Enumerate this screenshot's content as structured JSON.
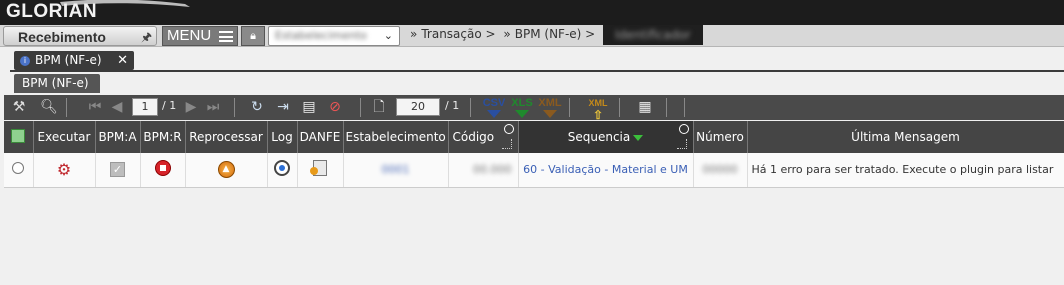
{
  "header": {
    "logo_text": "GLORIAN"
  },
  "navbar": {
    "module_label": "Recebimento",
    "menu_label": "MENU",
    "company_value": "Estabelecimento",
    "breadcrumbs": [
      "Transação >",
      "BPM (NF-e) >"
    ],
    "breadcrumb_current": "Identificador"
  },
  "tabs": {
    "active_tab": "BPM (NF-e)",
    "subtab": "BPM (NF-e)"
  },
  "toolbar": {
    "page_current": "1",
    "page_total": "/ 1",
    "page_size": "20",
    "page_size_total": "/ 1",
    "csv_label": "CSV",
    "xls_label": "XLS",
    "xml_label": "XML",
    "xml2_label": "XML"
  },
  "table": {
    "columns": [
      "Executar",
      "BPM:A",
      "BPM:R",
      "Reprocessar",
      "Log",
      "DANFE",
      "Estabelecimento",
      "Código",
      "Sequencia",
      "Número",
      "Última Mensagem"
    ],
    "rows": [
      {
        "estabelecimento": "0001",
        "codigo": "00.000",
        "sequencia": "60 - Validação - Material e UM",
        "numero": "00000",
        "ultima_mensagem": "Há 1 erro para ser tratado. Execute o plugin para listar"
      }
    ]
  }
}
